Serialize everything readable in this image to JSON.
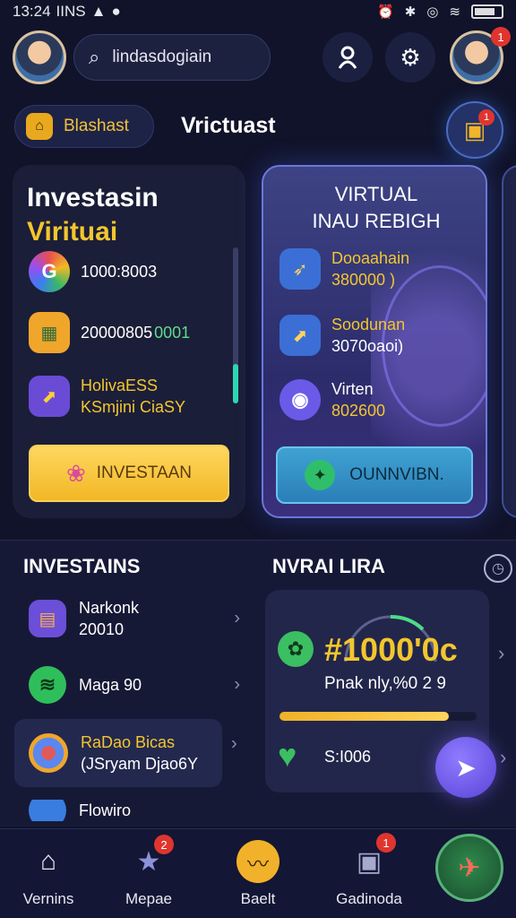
{
  "status": {
    "time": "13:24",
    "left_text": "IINS",
    "carrier_icon": "signal-bars-icon",
    "right_icons": [
      "alarm-icon",
      "bluetooth-icon",
      "nfc-icon",
      "wifi-icon",
      "battery-icon"
    ]
  },
  "header": {
    "search_value": "lindasdogiain",
    "profile_badge": "1",
    "user_icon_name": "user-icon",
    "settings_icon_name": "gear-icon"
  },
  "balance": {
    "label": "Blashast",
    "title": "Vrictuast",
    "gift_badge": "1"
  },
  "left_card": {
    "title_line1": "Investasin",
    "title_line2": "Virituai",
    "items": [
      {
        "text1": "1000:8003",
        "text2": ""
      },
      {
        "text1": "20000805",
        "text2": "0001"
      },
      {
        "text1": "HolivaESS",
        "text2": "KSmjini CiaSY"
      }
    ],
    "button_label": "INVESTAAN"
  },
  "right_card": {
    "title_line1": "VIRTUAL",
    "title_line2": "INAU REBIGH",
    "items": [
      {
        "text1": "Dooaahain",
        "text2": "380000 )"
      },
      {
        "text1": "Soodunan",
        "text2": "3070oaoi)"
      },
      {
        "text1": "Virten",
        "text2": "802600"
      }
    ],
    "button_label": "OUNNVIBN."
  },
  "investments": {
    "title": "INVESTAINS",
    "items": [
      {
        "text1": "Narkonk",
        "text2": "20010"
      },
      {
        "text1": "Maga 90",
        "text2": ""
      },
      {
        "text1": "RaDao Bicas",
        "text2": "(JSryam Djao6Y"
      },
      {
        "text1": "Flowiro",
        "text2": ""
      }
    ]
  },
  "portfolio": {
    "title": "NVRAI LIRA",
    "amount": "#1000'0c",
    "subtitle": "Pnak nly,%0 2 9",
    "progress": 0.86,
    "footer_text": "S:I006"
  },
  "tabs": [
    {
      "label": "Vernins",
      "icon": "home-icon",
      "badge": ""
    },
    {
      "label": "Mepae",
      "icon": "star-icon",
      "badge": "2"
    },
    {
      "label": "Baelt",
      "icon": "chart-icon",
      "badge": ""
    },
    {
      "label": "Gadinoda",
      "icon": "device-icon",
      "badge": "1"
    }
  ],
  "colors": {
    "background": "#11132a",
    "accent_yellow": "#f3c62e",
    "accent_purple": "#6b78d8",
    "accent_teal": "#3fa2d2"
  }
}
